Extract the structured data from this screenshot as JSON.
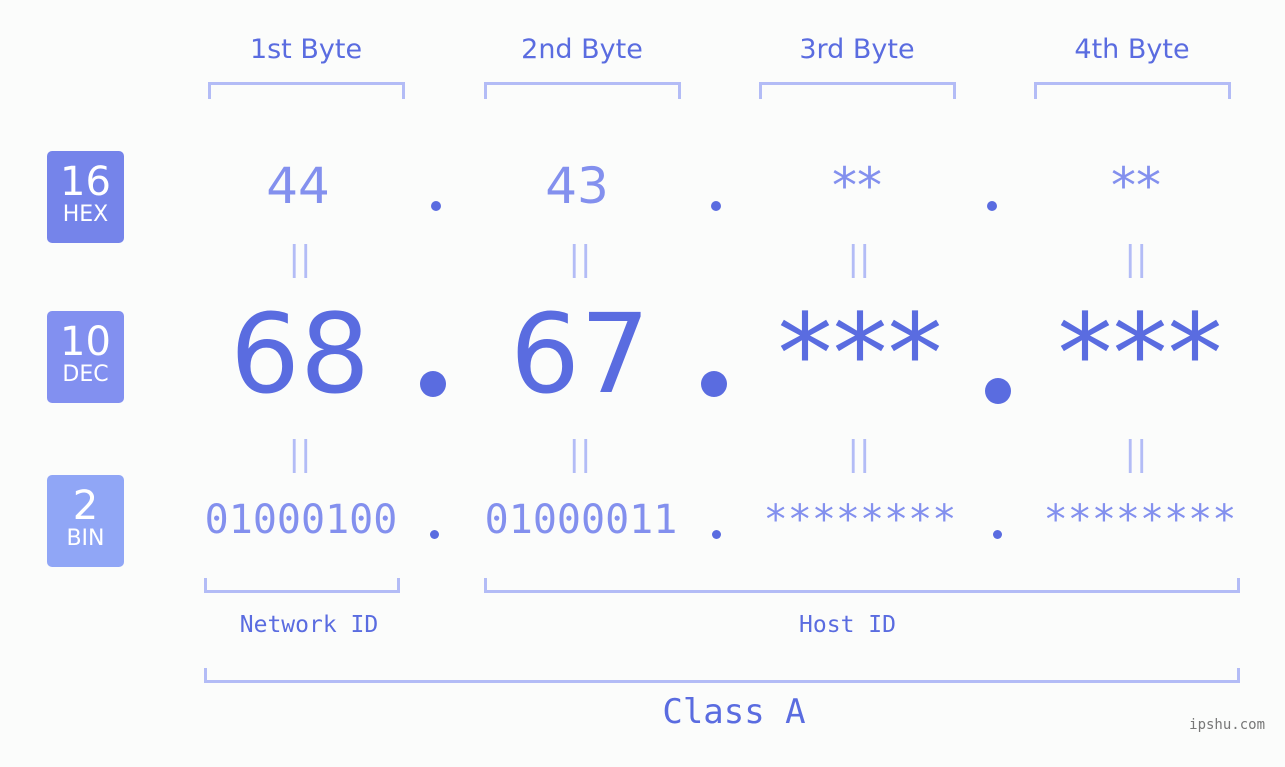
{
  "byte_headers": [
    "1st Byte",
    "2nd Byte",
    "3rd Byte",
    "4th Byte"
  ],
  "badges": [
    {
      "num": "16",
      "label": "HEX",
      "color": "#7584ea"
    },
    {
      "num": "10",
      "label": "DEC",
      "color": "#8290f0"
    },
    {
      "num": "2",
      "label": "BIN",
      "color": "#90a6f6"
    }
  ],
  "hex": [
    "44",
    "43",
    "**",
    "**"
  ],
  "dec": [
    "68",
    "67",
    "***",
    "***"
  ],
  "bin": [
    "01000100",
    "01000011",
    "********",
    "********"
  ],
  "equals_sign": "||",
  "network_label": "Network ID",
  "host_label": "Host ID",
  "class_label": "Class A",
  "watermark": "ipshu.com",
  "colors": {
    "accent": "#5a6ce0",
    "light": "#8390ee",
    "bracket": "#b3bcf6"
  }
}
